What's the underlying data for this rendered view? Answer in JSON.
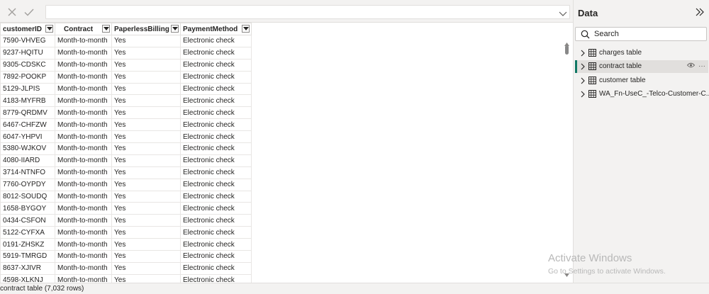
{
  "formula_bar": {
    "cancel_icon": "close-icon",
    "commit_icon": "checkmark-icon"
  },
  "table": {
    "columns": [
      "customerID",
      "Contract",
      "PaperlessBilling",
      "PaymentMethod"
    ],
    "rows": [
      [
        "7590-VHVEG",
        "Month-to-month",
        "Yes",
        "Electronic check"
      ],
      [
        "9237-HQITU",
        "Month-to-month",
        "Yes",
        "Electronic check"
      ],
      [
        "9305-CDSKC",
        "Month-to-month",
        "Yes",
        "Electronic check"
      ],
      [
        "7892-POOKP",
        "Month-to-month",
        "Yes",
        "Electronic check"
      ],
      [
        "5129-JLPIS",
        "Month-to-month",
        "Yes",
        "Electronic check"
      ],
      [
        "4183-MYFRB",
        "Month-to-month",
        "Yes",
        "Electronic check"
      ],
      [
        "8779-QRDMV",
        "Month-to-month",
        "Yes",
        "Electronic check"
      ],
      [
        "6467-CHFZW",
        "Month-to-month",
        "Yes",
        "Electronic check"
      ],
      [
        "6047-YHPVI",
        "Month-to-month",
        "Yes",
        "Electronic check"
      ],
      [
        "5380-WJKOV",
        "Month-to-month",
        "Yes",
        "Electronic check"
      ],
      [
        "4080-IIARD",
        "Month-to-month",
        "Yes",
        "Electronic check"
      ],
      [
        "3714-NTNFO",
        "Month-to-month",
        "Yes",
        "Electronic check"
      ],
      [
        "7760-OYPDY",
        "Month-to-month",
        "Yes",
        "Electronic check"
      ],
      [
        "8012-SOUDQ",
        "Month-to-month",
        "Yes",
        "Electronic check"
      ],
      [
        "1658-BYGOY",
        "Month-to-month",
        "Yes",
        "Electronic check"
      ],
      [
        "0434-CSFON",
        "Month-to-month",
        "Yes",
        "Electronic check"
      ],
      [
        "5122-CYFXA",
        "Month-to-month",
        "Yes",
        "Electronic check"
      ],
      [
        "0191-ZHSKZ",
        "Month-to-month",
        "Yes",
        "Electronic check"
      ],
      [
        "5919-TMRGD",
        "Month-to-month",
        "Yes",
        "Electronic check"
      ],
      [
        "8637-XJIVR",
        "Month-to-month",
        "Yes",
        "Electronic check"
      ],
      [
        "4598-XLKNJ",
        "Month-to-month",
        "Yes",
        "Electronic check"
      ]
    ]
  },
  "data_pane": {
    "title": "Data",
    "search_placeholder": "Search",
    "items": [
      {
        "label": "charges table",
        "selected": false
      },
      {
        "label": "contract table",
        "selected": true
      },
      {
        "label": "customer table",
        "selected": false
      },
      {
        "label": "WA_Fn-UseC_-Telco-Customer-C...",
        "selected": false
      }
    ]
  },
  "status_bar": {
    "text": "contract table (7,032 rows)"
  },
  "watermark": {
    "title": "Activate Windows",
    "subtitle": "Go to Settings to activate Windows."
  },
  "colors": {
    "accent": "#117865",
    "pane_bg": "#f3f2f1"
  }
}
